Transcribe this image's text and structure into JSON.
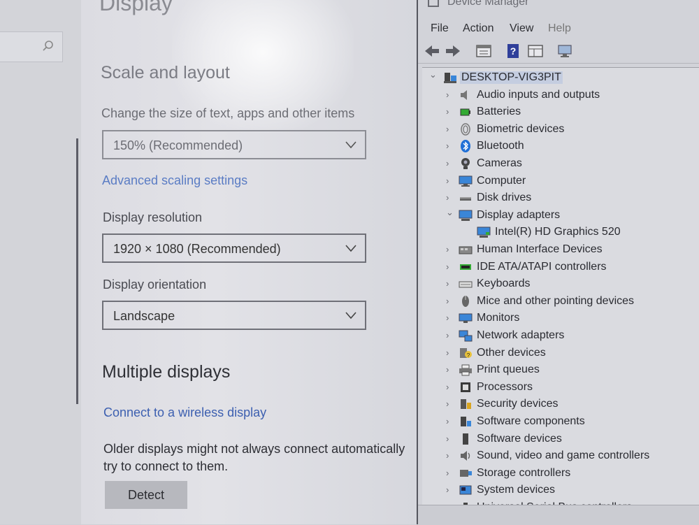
{
  "settings": {
    "page_title": "Display",
    "scale_section": "Scale and layout",
    "scale_label": "Change the size of text, apps and other items",
    "scale_value": "150% (Recommended)",
    "advanced_link": "Advanced scaling settings",
    "resolution_label": "Display resolution",
    "resolution_value": "1920 × 1080 (Recommended)",
    "orientation_label": "Display orientation",
    "orientation_value": "Landscape",
    "multiple_section": "Multiple displays",
    "wireless_link": "Connect to a wireless display",
    "older_line1": "Older displays might not always connect automatically",
    "older_line2": "try to connect to them.",
    "detect_button": "Detect"
  },
  "device_manager": {
    "title": "Device Manager",
    "menu": [
      "File",
      "Action",
      "View",
      "Help"
    ],
    "root": "DESKTOP-VIG3PIT",
    "categories": [
      {
        "label": "Audio inputs and outputs",
        "icon": "speaker-icon"
      },
      {
        "label": "Batteries",
        "icon": "battery-icon"
      },
      {
        "label": "Biometric devices",
        "icon": "fingerprint-icon"
      },
      {
        "label": "Bluetooth",
        "icon": "bluetooth-icon"
      },
      {
        "label": "Cameras",
        "icon": "camera-icon"
      },
      {
        "label": "Computer",
        "icon": "computer-icon"
      },
      {
        "label": "Disk drives",
        "icon": "disk-icon"
      },
      {
        "label": "Display adapters",
        "icon": "display-adapter-icon",
        "expanded": true,
        "children": [
          "Intel(R) HD Graphics 520"
        ]
      },
      {
        "label": "Human Interface Devices",
        "icon": "hid-icon"
      },
      {
        "label": "IDE ATA/ATAPI controllers",
        "icon": "ide-icon"
      },
      {
        "label": "Keyboards",
        "icon": "keyboard-icon"
      },
      {
        "label": "Mice and other pointing devices",
        "icon": "mouse-icon"
      },
      {
        "label": "Monitors",
        "icon": "monitor-icon"
      },
      {
        "label": "Network adapters",
        "icon": "network-icon"
      },
      {
        "label": "Other devices",
        "icon": "other-devices-icon"
      },
      {
        "label": "Print queues",
        "icon": "printer-icon"
      },
      {
        "label": "Processors",
        "icon": "processor-icon"
      },
      {
        "label": "Security devices",
        "icon": "security-icon"
      },
      {
        "label": "Software components",
        "icon": "software-component-icon"
      },
      {
        "label": "Software devices",
        "icon": "software-device-icon"
      },
      {
        "label": "Sound, video and game controllers",
        "icon": "sound-icon"
      },
      {
        "label": "Storage controllers",
        "icon": "storage-icon"
      },
      {
        "label": "System devices",
        "icon": "system-icon"
      },
      {
        "label": "Universal Serial Bus controllers",
        "icon": "usb-icon"
      }
    ]
  },
  "colors": {
    "link": "#3c5fb0",
    "selection": "#c4cde0",
    "bluetooth": "#1f6fd6",
    "monitor": "#3a86d8"
  }
}
